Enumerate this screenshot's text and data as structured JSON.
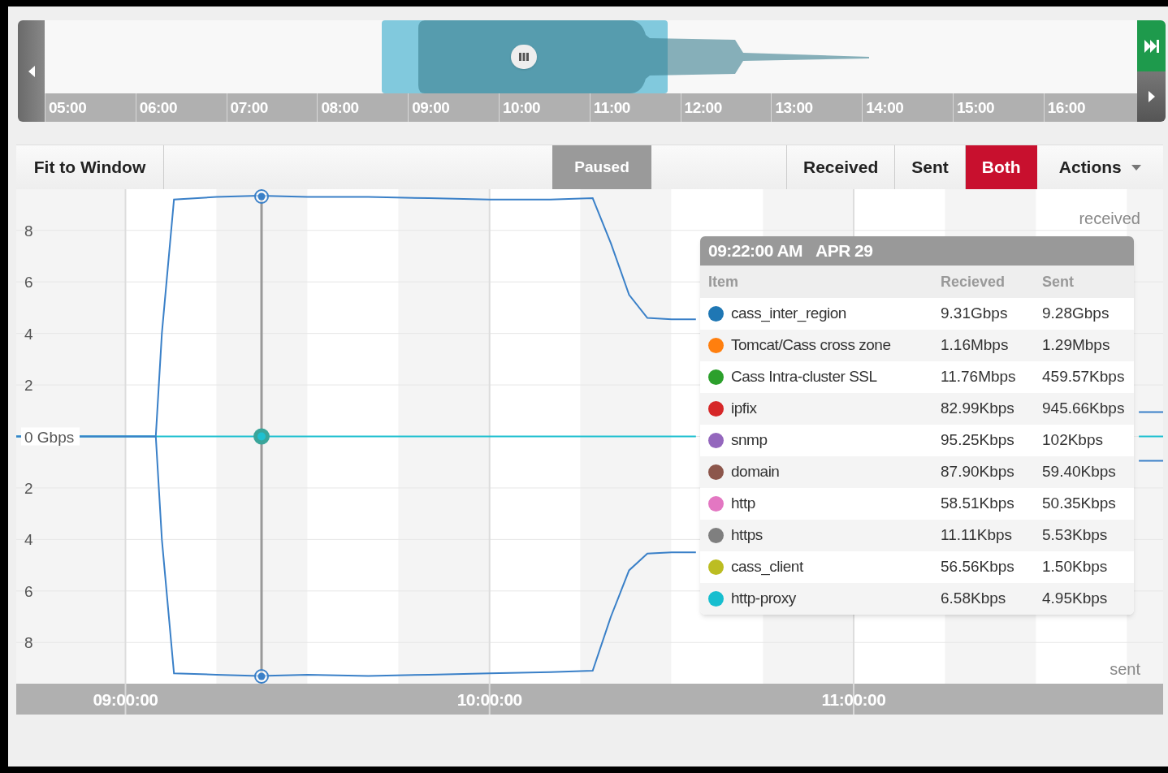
{
  "timeline": {
    "hour_labels": [
      "05:00",
      "06:00",
      "07:00",
      "08:00",
      "09:00",
      "10:00",
      "11:00",
      "12:00",
      "13:00",
      "14:00",
      "15:00",
      "16:00"
    ]
  },
  "toolbar": {
    "fit_button": "Fit to Window",
    "status_button": {
      "label": "Paused",
      "active": true
    },
    "view_tabs": [
      {
        "label": "Received",
        "selected": false
      },
      {
        "label": "Sent",
        "selected": false
      },
      {
        "label": "Both",
        "selected": true
      }
    ],
    "actions_menu": "Actions"
  },
  "chart": {
    "top_label": "received",
    "bottom_label": "sent",
    "chart_data": {
      "type": "line",
      "x": [
        8.7,
        9.0833,
        9.1,
        9.1333,
        9.25,
        9.3667,
        9.5,
        9.6667,
        9.8333,
        10,
        10.1667,
        10.2833,
        10.3333,
        10.3833,
        10.4333,
        10.5,
        10.5667,
        10.6667,
        11.6667,
        11.7833,
        11.85
      ],
      "series": [
        {
          "color": "#3a80c8",
          "values": [
            0,
            0,
            4,
            9.2,
            9.3,
            9.35,
            9.3,
            9.3,
            9.25,
            9.2,
            9.2,
            9.25,
            7.5,
            5.5,
            4.6,
            4.55,
            4.55,
            null,
            null,
            0.95,
            0.95
          ]
        },
        {
          "color": "#1fc0d0",
          "values": [
            0,
            0,
            0,
            0,
            0,
            0,
            0,
            0,
            0,
            0,
            0,
            0,
            0,
            0,
            0,
            0,
            0,
            null,
            null,
            0,
            0
          ]
        },
        {
          "color": "#3a80c8",
          "values": [
            0,
            0,
            -4,
            -9.2,
            -9.25,
            -9.3,
            -9.25,
            -9.3,
            -9.25,
            -9.2,
            -9.15,
            -9.1,
            -7,
            -5.2,
            -4.55,
            -4.5,
            -4.5,
            null,
            null,
            -0.95,
            -0.95
          ]
        }
      ],
      "grid": true,
      "xlim": [
        8.7,
        11.85
      ],
      "ylim": [
        -9.6,
        9.6
      ],
      "xticks": [
        {
          "value": 9,
          "label": "09:00:00"
        },
        {
          "value": 10,
          "label": "10:00:00"
        },
        {
          "value": 11,
          "label": "11:00:00"
        }
      ],
      "yticks": [
        {
          "value": 8,
          "label": "8"
        },
        {
          "value": 6,
          "label": "6"
        },
        {
          "value": 4,
          "label": "4"
        },
        {
          "value": 2,
          "label": "2"
        },
        {
          "value": 0,
          "label": "0 Gbps"
        },
        {
          "value": -2,
          "label": "2"
        },
        {
          "value": -4,
          "label": "4"
        },
        {
          "value": -6,
          "label": "6"
        },
        {
          "value": -8,
          "label": "8"
        }
      ]
    }
  },
  "tooltip": {
    "time": "09:22:00 AM",
    "date": "APR 29",
    "columns": [
      "Item",
      "Recieved",
      "Sent"
    ],
    "rows": [
      {
        "color": "#1f77b4",
        "item": "cass_inter_region",
        "received": "9.31Gbps",
        "sent": "9.28Gbps"
      },
      {
        "color": "#ff7f0e",
        "item": "Tomcat/Cass cross zone",
        "received": "1.16Mbps",
        "sent": "1.29Mbps"
      },
      {
        "color": "#2ca02c",
        "item": "Cass Intra-cluster SSL",
        "received": "11.76Mbps",
        "sent": "459.57Kbps"
      },
      {
        "color": "#d62728",
        "item": "ipfix",
        "received": "82.99Kbps",
        "sent": "945.66Kbps"
      },
      {
        "color": "#9467bd",
        "item": "snmp",
        "received": "95.25Kbps",
        "sent": "102Kbps"
      },
      {
        "color": "#8c564b",
        "item": "domain",
        "received": "87.90Kbps",
        "sent": "59.40Kbps"
      },
      {
        "color": "#e377c2",
        "item": "http",
        "received": "58.51Kbps",
        "sent": "50.35Kbps"
      },
      {
        "color": "#7f7f7f",
        "item": "https",
        "received": "11.11Kbps",
        "sent": "5.53Kbps"
      },
      {
        "color": "#bcbd22",
        "item": "cass_client",
        "received": "56.56Kbps",
        "sent": "1.50Kbps"
      },
      {
        "color": "#17becf",
        "item": "http-proxy",
        "received": "6.58Kbps",
        "sent": "4.95Kbps"
      }
    ]
  }
}
